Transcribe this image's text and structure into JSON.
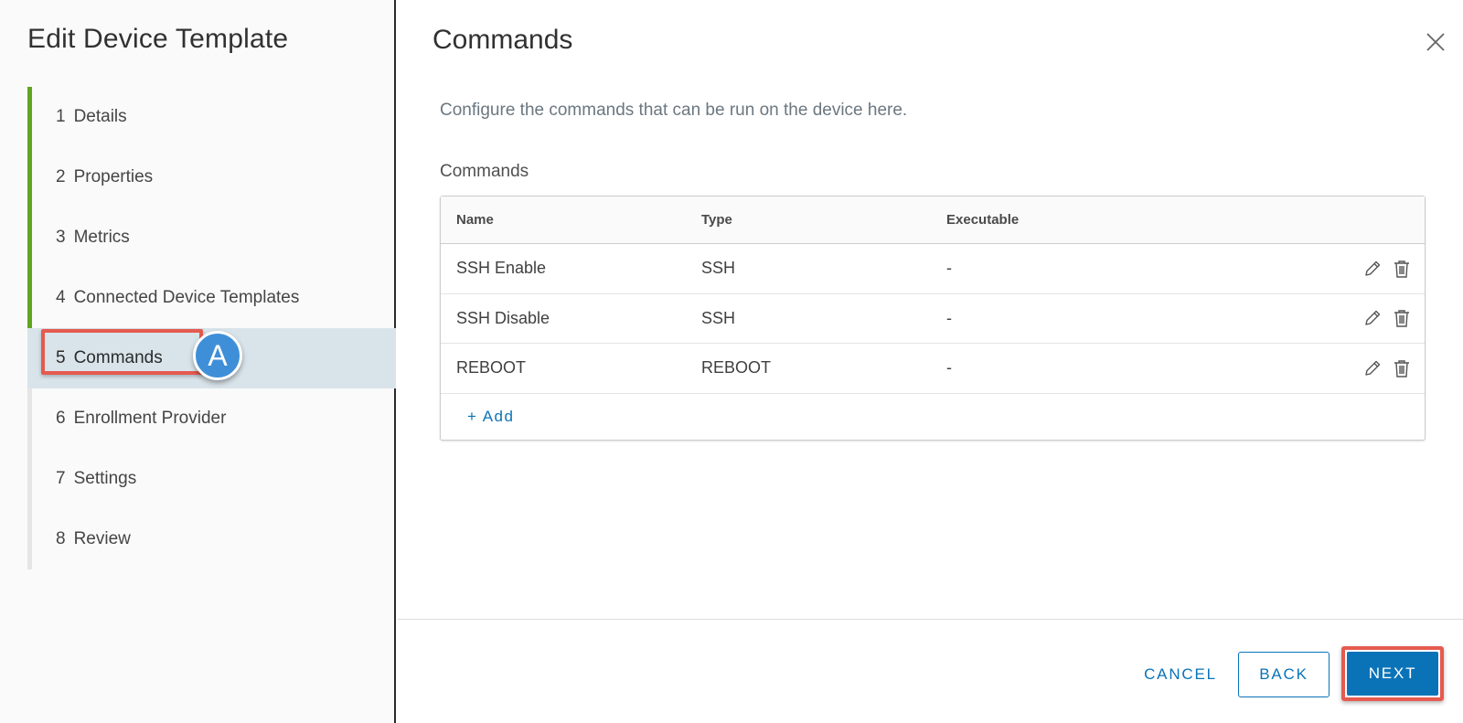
{
  "sidebar": {
    "title": "Edit Device Template",
    "steps": [
      {
        "num": "1",
        "label": "Details",
        "state": "done"
      },
      {
        "num": "2",
        "label": "Properties",
        "state": "done"
      },
      {
        "num": "3",
        "label": "Metrics",
        "state": "done"
      },
      {
        "num": "4",
        "label": "Connected Device Templates",
        "state": "done"
      },
      {
        "num": "5",
        "label": "Commands",
        "state": "active"
      },
      {
        "num": "6",
        "label": "Enrollment Provider",
        "state": "pending"
      },
      {
        "num": "7",
        "label": "Settings",
        "state": "pending"
      },
      {
        "num": "8",
        "label": "Review",
        "state": "pending"
      }
    ],
    "callout_label": "A"
  },
  "main": {
    "title": "Commands",
    "close_icon": "close-icon",
    "intro": "Configure the commands that can be run on the device here.",
    "section_label": "Commands",
    "table": {
      "columns": [
        "Name",
        "Type",
        "Executable"
      ],
      "rows": [
        {
          "name": "SSH Enable",
          "type": "SSH",
          "executable": "-"
        },
        {
          "name": "SSH Disable",
          "type": "SSH",
          "executable": "-"
        },
        {
          "name": "REBOOT",
          "type": "REBOOT",
          "executable": "-"
        }
      ],
      "add_label": "+ Add"
    }
  },
  "footer": {
    "cancel_label": "CANCEL",
    "back_label": "BACK",
    "next_label": "NEXT"
  },
  "colors": {
    "accent": "#0a73b8",
    "progress": "#62a420",
    "highlight": "#e55a4f",
    "callout": "#3f8fd8",
    "active_step_bg": "#d9e4ea"
  }
}
